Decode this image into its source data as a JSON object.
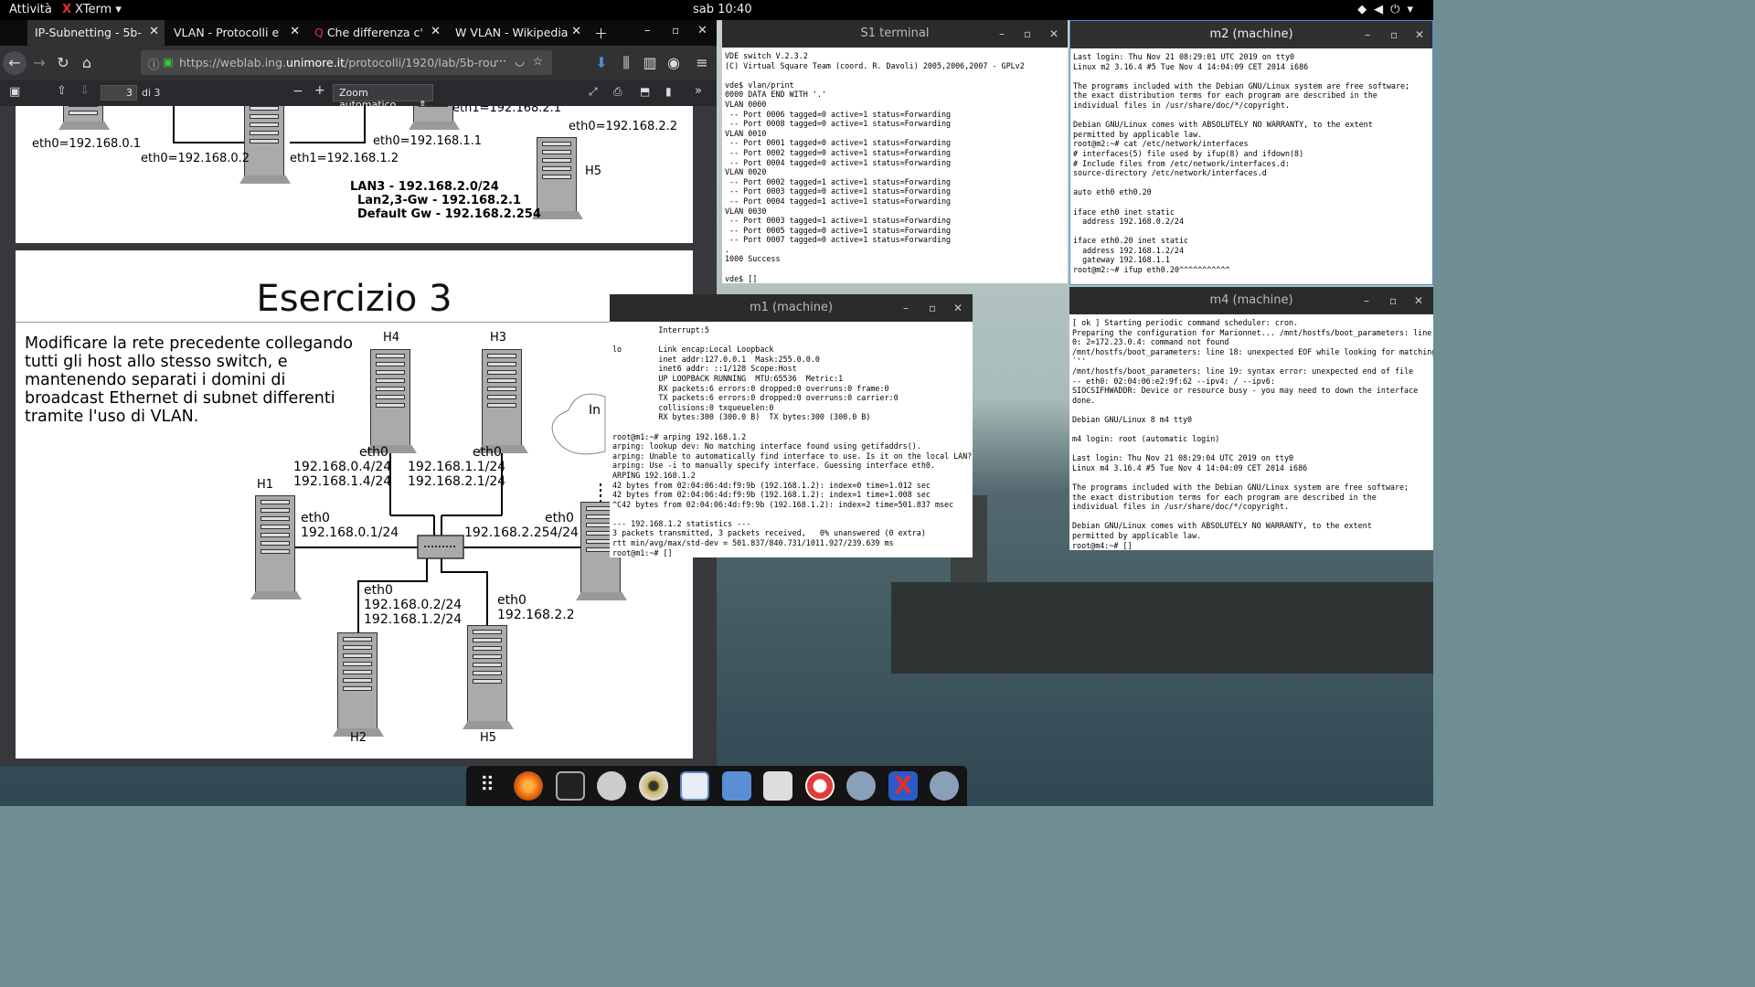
{
  "topbar": {
    "activities": "Attività",
    "app": "XTerm",
    "app_icon": "X",
    "clock": "sab 10:40",
    "tray": "wifi-icon volume-icon power-icon"
  },
  "browser": {
    "tabs": [
      {
        "label": "IP-Subnetting - 5b-ro"
      },
      {
        "label": "VLAN - Protocolli e Ar"
      },
      {
        "label": "Che differenza c'è t"
      },
      {
        "label": "VLAN - Wikipedia"
      }
    ],
    "url": {
      "prefix": "https://weblab.ing.",
      "host": "unimore.it",
      "path": "/protocolli/1920/lab/5b-rou"
    },
    "pdf": {
      "page": "3",
      "of": "di 3",
      "zoom": "Zoom automatico"
    },
    "page1": {
      "labels": [
        "eth0=192.168.0.1",
        "eth0=192.168.0.2",
        "eth1=192.168.1.2",
        "eth0=192.168.1.1",
        "eth1=192.168.2.1",
        "eth0=192.168.2.2",
        "H5",
        "LAN3 - 192.168.2.0/24",
        "Lan2,3-Gw  - 192.168.2.1",
        "Default Gw  - 192.168.2.254"
      ]
    },
    "page2": {
      "title": "Esercizio 3",
      "desc": "Modificare la rete precedente collegando tutti gli host allo stesso switch, e mantenendo separati i domini di broadcast Ethernet di subnet differenti tramite l'uso di VLAN.",
      "h4": "H4",
      "h3": "H3",
      "h1": "H1",
      "h2": "H2",
      "h5": "H5",
      "cloud": "In",
      "h4_eth": "eth0",
      "h4_ip1": "192.168.0.4/24",
      "h4_ip2": "192.168.1.4/24",
      "h3_eth": "eth0",
      "h3_ip1": "192.168.1.1/24",
      "h3_ip2": "192.168.2.1/24",
      "h1_eth": "eth0",
      "h1_ip": "192.168.0.1/24",
      "r_eth": "eth0",
      "r_ip": "192.168.2.254/24",
      "h2_eth": "eth0",
      "h2_ip1": "192.168.0.2/24",
      "h2_ip2": "192.168.1.2/24",
      "h5_eth": "eth0",
      "h5_ip": "192.168.2.2"
    }
  },
  "windows": {
    "s1": {
      "title": "S1 terminal",
      "text": "VDE switch V.2.3.2\n(C) Virtual Square Team (coord. R. Davoli) 2005,2006,2007 - GPLv2\n\nvde$ vlan/print\n0000 DATA END WITH '.'\nVLAN 0000\n -- Port 0006 tagged=0 active=1 status=Forwarding\n -- Port 0008 tagged=0 active=1 status=Forwarding\nVLAN 0010\n -- Port 0001 tagged=0 active=1 status=Forwarding\n -- Port 0002 tagged=0 active=1 status=Forwarding\n -- Port 0004 tagged=0 active=1 status=Forwarding\nVLAN 0020\n -- Port 0002 tagged=1 active=1 status=Forwarding\n -- Port 0003 tagged=0 active=1 status=Forwarding\n -- Port 0004 tagged=1 active=1 status=Forwarding\nVLAN 0030\n -- Port 0003 tagged=1 active=1 status=Forwarding\n -- Port 0005 tagged=0 active=1 status=Forwarding\n -- Port 0007 tagged=0 active=1 status=Forwarding\n.\n1000 Success\n\nvde$ []"
    },
    "m2": {
      "title": "m2 (machine)",
      "text": "Last login: Thu Nov 21 08:29:01 UTC 2019 on tty0\nLinux m2 3.16.4 #5 Tue Nov 4 14:04:09 CET 2014 i686\n\nThe programs included with the Debian GNU/Linux system are free software;\nthe exact distribution terms for each program are described in the\nindividual files in /usr/share/doc/*/copyright.\n\nDebian GNU/Linux comes with ABSOLUTELY NO WARRANTY, to the extent\npermitted by applicable law.\nroot@m2:~# cat /etc/network/interfaces\n# interfaces(5) file used by ifup(8) and ifdown(8)\n# Include files from /etc/network/interfaces.d:\nsource-directory /etc/network/interfaces.d\n\nauto eth0 eth0.20\n\niface eth0 inet static\n  address 192.168.0.2/24\n\niface eth0.20 inet static\n  address 192.168.1.2/24\n  gateway 192.168.1.1\nroot@m2:~# ifup eth0.20^^^^^^^^^^^"
    },
    "m1": {
      "title": "m1 (machine)",
      "text": "          Interrupt:5\n\nlo        Link encap:Local Loopback\n          inet addr:127.0.0.1  Mask:255.0.0.0\n          inet6 addr: ::1/128 Scope:Host\n          UP LOOPBACK RUNNING  MTU:65536  Metric:1\n          RX packets:6 errors:0 dropped:0 overruns:0 frame:0\n          TX packets:6 errors:0 dropped:0 overruns:0 carrier:0\n          collisions:0 txqueuelen:0\n          RX bytes:300 (300.0 B)  TX bytes:300 (300.0 B)\n\nroot@m1:~# arping 192.168.1.2\narping: lookup dev: No matching interface found using getifaddrs().\narping: Unable to automatically find interface to use. Is it on the local LAN?\narping: Use -i to manually specify interface. Guessing interface eth0.\nARPING 192.168.1.2\n42 bytes from 02:04:06:4d:f9:9b (192.168.1.2): index=0 time=1.012 sec\n42 bytes from 02:04:06:4d:f9:9b (192.168.1.2): index=1 time=1.008 sec\n^C42 bytes from 02:04:06:4d:f9:9b (192.168.1.2): index=2 time=501.837 msec\n\n--- 192.168.1.2 statistics ---\n3 packets transmitted, 3 packets received,   0% unanswered (0 extra)\nrtt min/avg/max/std-dev = 501.837/840.731/1011.927/239.639 ms\nroot@m1:~# []"
    },
    "m4": {
      "title": "m4 (machine)",
      "text": "[ ok ] Starting periodic command scheduler: cron.\nPreparing the configuration for Marionnet... /mnt/hostfs/boot_parameters: line 1\n0: 2=172.23.0.4: command not found\n/mnt/hostfs/boot_parameters: line 18: unexpected EOF while looking for matching\n`''\n/mnt/hostfs/boot_parameters: line 19: syntax error: unexpected end of file\n-- eth0: 02:04:06:e2:9f:62 --ipv4: / --ipv6:\nSIOCSIFHWADDR: Device or resource busy - you may need to down the interface\ndone.\n\nDebian GNU/Linux 8 m4 tty0\n\nm4 login: root (automatic login)\n\nLast login: Thu Nov 21 08:29:04 UTC 2019 on tty0\nLinux m4 3.16.4 #5 Tue Nov 4 14:04:09 CET 2014 i686\n\nThe programs included with the Debian GNU/Linux system are free software;\nthe exact distribution terms for each program are described in the\nindividual files in /usr/share/doc/*/copyright.\n\nDebian GNU/Linux comes with ABSOLUTELY NO WARRANTY, to the extent\npermitted by applicable law.\nroot@m4:~# []"
    }
  },
  "dock": [
    "apps-grid-icon",
    "firefox-icon",
    "terminal-icon",
    "network-icon",
    "disc-icon",
    "document-icon",
    "archive-icon",
    "screenshot-icon",
    "help-icon",
    "marionnet-icon",
    "xterm-icon",
    "marionnet-icon"
  ],
  "colors": {
    "topbar": "#000000",
    "tabbar": "#0c0c0d",
    "titlebar": "#2b2b2b",
    "accent": "#4a90d9"
  }
}
